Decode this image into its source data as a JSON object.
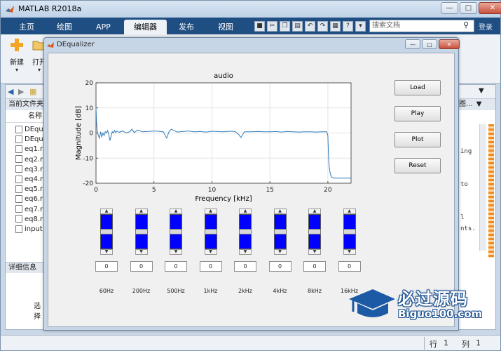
{
  "app": {
    "title": "MATLAB R2018a"
  },
  "ribbon_tabs": [
    {
      "label": "主页"
    },
    {
      "label": "绘图"
    },
    {
      "label": "APP"
    },
    {
      "label": "编辑器"
    },
    {
      "label": "发布"
    },
    {
      "label": "视图"
    }
  ],
  "search": {
    "placeholder": "搜索文档",
    "login": "登录"
  },
  "ribbon": {
    "new_label": "新建",
    "open_label": "打开"
  },
  "file_browser": {
    "header": "当前文件夹",
    "column": "名称",
    "files": [
      {
        "name": "DEqu"
      },
      {
        "name": "DEqu"
      },
      {
        "name": "eq1.r"
      },
      {
        "name": "eq2.r"
      },
      {
        "name": "eq3.r"
      },
      {
        "name": "eq4.r"
      },
      {
        "name": "eq5.r"
      },
      {
        "name": "eq6.r"
      },
      {
        "name": "eq7.r"
      },
      {
        "name": "eq8.r"
      },
      {
        "name": "input"
      }
    ],
    "details": "详细信息",
    "select_hint": "选择"
  },
  "right_panel": {
    "header": "图...",
    "code_lines": [
      "ing",
      "to",
      "l",
      "nts."
    ]
  },
  "status": {
    "row_label": "行",
    "row": "1",
    "col_label": "列",
    "col": "1"
  },
  "dequalizer": {
    "title": "DEqualizer",
    "buttons": {
      "load": "Load",
      "play": "Play",
      "plot": "Plot",
      "reset": "Reset"
    },
    "bands": [
      {
        "label": "60Hz",
        "value": "0",
        "level": 0.5
      },
      {
        "label": "200Hz",
        "value": "0",
        "level": 0.5
      },
      {
        "label": "500Hz",
        "value": "0",
        "level": 0.5
      },
      {
        "label": "1kHz",
        "value": "0",
        "level": 0.5
      },
      {
        "label": "2kHz",
        "value": "0",
        "level": 0.5
      },
      {
        "label": "4kHz",
        "value": "0",
        "level": 0.5
      },
      {
        "label": "8kHz",
        "value": "0",
        "level": 0.5
      },
      {
        "label": "16kHz",
        "value": "0",
        "level": 0.5
      }
    ]
  },
  "chart_data": {
    "type": "line",
    "title": "audio",
    "xlabel": "Frequency [kHz]",
    "ylabel": "Magnitude [dB]",
    "xlim": [
      0,
      22
    ],
    "ylim": [
      -20,
      20
    ],
    "xticks": [
      "0",
      "5",
      "10",
      "15",
      "20"
    ],
    "yticks": [
      "20",
      "10",
      "0",
      "-10",
      "-20"
    ],
    "grid": true,
    "color": "#2f7ab9",
    "series": [
      {
        "x": [
          0,
          0.05,
          0.1,
          0.2,
          0.3,
          0.4,
          0.5,
          0.6,
          0.7,
          0.8,
          0.9,
          1.0,
          1.1,
          1.2,
          1.4,
          1.5,
          1.6,
          1.7,
          1.8,
          2.0,
          2.3,
          2.6,
          2.9,
          3.1,
          3.3,
          3.6,
          4.0,
          4.5,
          5.0,
          5.4,
          5.8,
          6.1,
          6.3,
          6.5,
          7.0,
          7.5,
          8.0,
          8.5,
          9.0,
          9.5,
          10.0,
          10.5,
          11.0,
          11.5,
          12.0,
          12.3,
          12.5,
          12.8,
          13.3,
          14.0,
          14.5,
          15.0,
          15.5,
          16.0,
          16.5,
          17.0,
          17.5,
          18.0,
          18.5,
          19.0,
          19.5,
          19.9,
          20.0,
          20.05,
          20.1,
          20.2,
          20.3,
          20.5,
          21.0,
          21.5,
          22.0
        ],
        "y": [
          10,
          4,
          1,
          -1,
          -2,
          0.5,
          -1.5,
          0,
          -1,
          0.5,
          0,
          1,
          -0.5,
          -3,
          0.5,
          0,
          1,
          0.2,
          0.8,
          0.3,
          0.8,
          0,
          0.5,
          1.5,
          0.2,
          1.2,
          0.5,
          0.6,
          0.8,
          0.7,
          0.5,
          -2,
          0.5,
          1.5,
          0.4,
          0.6,
          0.8,
          0.5,
          0.6,
          0.4,
          0.7,
          0.6,
          0.5,
          0.7,
          0.6,
          -0.5,
          -1.8,
          0.5,
          0.5,
          0.6,
          0.5,
          0.5,
          0.6,
          0.4,
          0.6,
          0.5,
          0.4,
          0.5,
          0.5,
          0.4,
          0.5,
          0.5,
          -1,
          -8,
          -13,
          -16,
          -17.5,
          -18,
          -18,
          -18,
          -18
        ]
      }
    ]
  }
}
